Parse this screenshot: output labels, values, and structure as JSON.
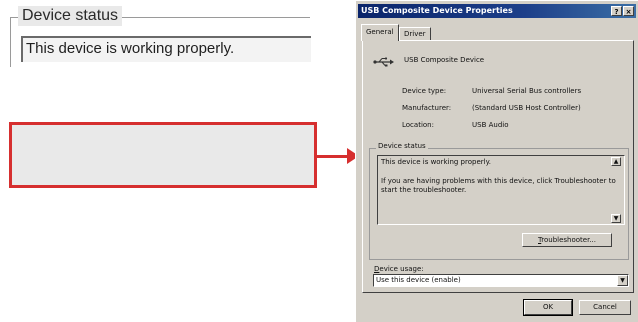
{
  "callout": {
    "legend": "Device status",
    "text": "This device is working properly."
  },
  "dialog": {
    "title": "USB Composite Device Properties",
    "help_icon": "?",
    "close_icon": "×",
    "tabs": [
      {
        "label": "General",
        "active": true
      },
      {
        "label": "Driver",
        "active": false
      }
    ],
    "device_icon": "usb-icon",
    "device_name": "USB Composite Device",
    "properties": [
      {
        "label": "Device type:",
        "value": "Universal Serial Bus controllers"
      },
      {
        "label": "Manufacturer:",
        "value": "(Standard USB Host Controller)"
      },
      {
        "label": "Location:",
        "value": "USB Audio"
      }
    ],
    "status": {
      "legend": "Device status",
      "lines": [
        "This device is working properly.",
        "",
        "If you are having problems with this device, click Troubleshooter to",
        "start the troubleshooter."
      ]
    },
    "troubleshooter_button": {
      "underline": "T",
      "rest": "roubleshooter..."
    },
    "usage": {
      "label_underline": "D",
      "label_rest": "evice usage:",
      "value": "Use this device (enable)"
    },
    "ok_button": "OK",
    "cancel_button": "Cancel"
  },
  "colors": {
    "callout_border": "#d62f2f",
    "titlebar": "#0a246a",
    "dialog_face": "#d4d0c8"
  }
}
